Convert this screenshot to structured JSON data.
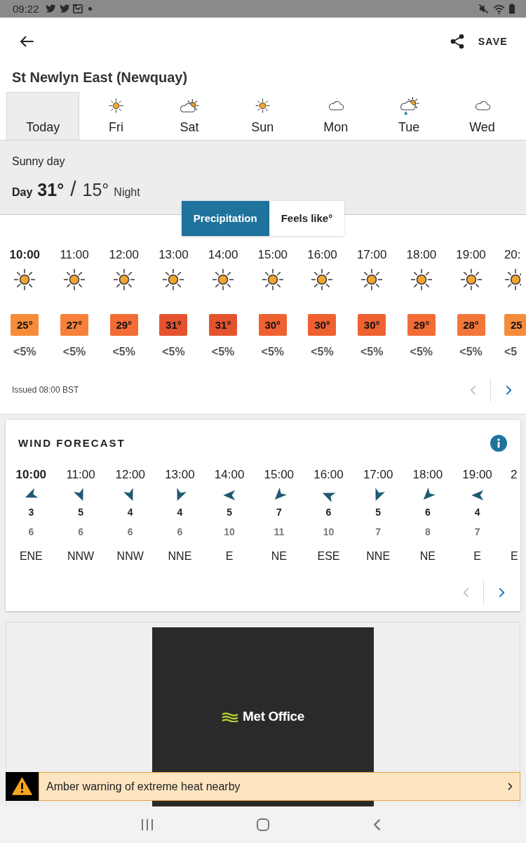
{
  "status_bar": {
    "time": "09:22"
  },
  "app_bar": {
    "save_label": "SAVE"
  },
  "location": {
    "title": "St Newlyn East (Newquay)"
  },
  "days": [
    {
      "label": "Today",
      "kind": "plain",
      "selected": true
    },
    {
      "label": "Fri",
      "kind": "sun",
      "selected": false
    },
    {
      "label": "Sat",
      "kind": "sun-cloud",
      "selected": false
    },
    {
      "label": "Sun",
      "kind": "sun",
      "selected": false
    },
    {
      "label": "Mon",
      "kind": "cloud",
      "selected": false
    },
    {
      "label": "Tue",
      "kind": "shower",
      "selected": false
    },
    {
      "label": "Wed",
      "kind": "cloud",
      "selected": false
    }
  ],
  "summary": {
    "description": "Sunny day",
    "day_label": "Day",
    "day_temp": "31°",
    "separator": "/",
    "night_temp": "15°",
    "night_label": "Night"
  },
  "view_toggle": [
    {
      "label": "Precipitation",
      "selected": true
    },
    {
      "label": "Feels like°",
      "selected": false
    }
  ],
  "hourly": [
    {
      "time": "10:00",
      "current": true,
      "temperature": "25°",
      "color": "#f68c3a",
      "precipitation": "<5%"
    },
    {
      "time": "11:00",
      "current": false,
      "temperature": "27°",
      "color": "#f6803a",
      "precipitation": "<5%"
    },
    {
      "time": "12:00",
      "current": false,
      "temperature": "29°",
      "color": "#f26c35",
      "precipitation": "<5%"
    },
    {
      "time": "13:00",
      "current": false,
      "temperature": "31°",
      "color": "#e5532e",
      "precipitation": "<5%"
    },
    {
      "time": "14:00",
      "current": false,
      "temperature": "31°",
      "color": "#e5532e",
      "precipitation": "<5%"
    },
    {
      "time": "15:00",
      "current": false,
      "temperature": "30°",
      "color": "#ef6131",
      "precipitation": "<5%"
    },
    {
      "time": "16:00",
      "current": false,
      "temperature": "30°",
      "color": "#ef6131",
      "precipitation": "<5%"
    },
    {
      "time": "17:00",
      "current": false,
      "temperature": "30°",
      "color": "#ef6131",
      "precipitation": "<5%"
    },
    {
      "time": "18:00",
      "current": false,
      "temperature": "29°",
      "color": "#f26c35",
      "precipitation": "<5%"
    },
    {
      "time": "19:00",
      "current": false,
      "temperature": "28°",
      "color": "#f3773a",
      "precipitation": "<5%"
    },
    {
      "time": "20:",
      "current": false,
      "temperature": "25",
      "color": "#f68c3a",
      "precipitation": "<5"
    }
  ],
  "issued": "Issued 08:00 BST",
  "hourly_pager": {
    "prev": {
      "disabled": true
    },
    "next": {
      "disabled": false
    }
  },
  "wind": {
    "title": "WIND FORECAST",
    "hours": [
      {
        "time": "10:00",
        "current": true,
        "speed": "3",
        "gust": "6",
        "direction": "ENE"
      },
      {
        "time": "11:00",
        "current": false,
        "speed": "5",
        "gust": "6",
        "direction": "NNW"
      },
      {
        "time": "12:00",
        "current": false,
        "speed": "4",
        "gust": "6",
        "direction": "NNW"
      },
      {
        "time": "13:00",
        "current": false,
        "speed": "4",
        "gust": "6",
        "direction": "NNE"
      },
      {
        "time": "14:00",
        "current": false,
        "speed": "5",
        "gust": "10",
        "direction": "E"
      },
      {
        "time": "15:00",
        "current": false,
        "speed": "7",
        "gust": "11",
        "direction": "NE"
      },
      {
        "time": "16:00",
        "current": false,
        "speed": "6",
        "gust": "10",
        "direction": "ESE"
      },
      {
        "time": "17:00",
        "current": false,
        "speed": "5",
        "gust": "7",
        "direction": "NNE"
      },
      {
        "time": "18:00",
        "current": false,
        "speed": "6",
        "gust": "8",
        "direction": "NE"
      },
      {
        "time": "19:00",
        "current": false,
        "speed": "4",
        "gust": "7",
        "direction": "E"
      },
      {
        "time": "2",
        "current": false,
        "direction": "E"
      }
    ],
    "pager": {
      "prev": {
        "disabled": true
      },
      "next": {
        "disabled": false
      }
    }
  },
  "advert": {
    "logo_text": "Met Office"
  },
  "warning": {
    "text": "Amber warning of extreme heat nearby"
  }
}
